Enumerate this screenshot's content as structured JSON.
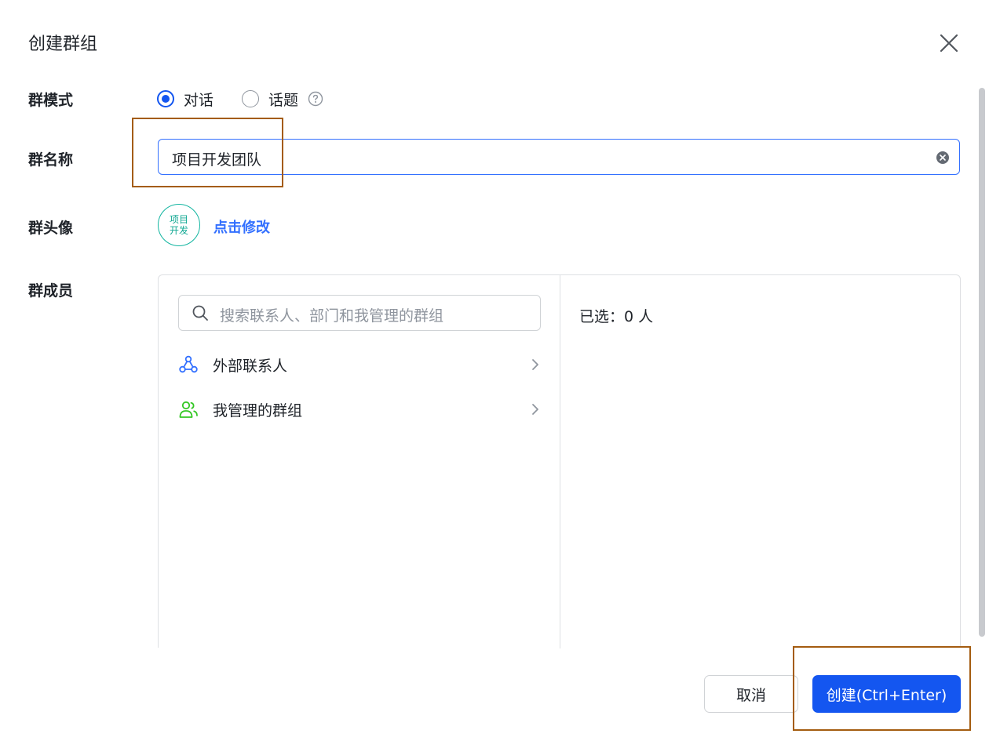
{
  "dialog": {
    "title": "创建群组"
  },
  "form": {
    "mode_label": "群模式",
    "mode_options": [
      "对话",
      "话题"
    ],
    "mode_selected": "对话",
    "name_label": "群名称",
    "name_value": "项目开发团队",
    "avatar_label": "群头像",
    "avatar_text_line1": "项目",
    "avatar_text_line2": "开发",
    "avatar_modify": "点击修改",
    "members_label": "群成员"
  },
  "members": {
    "search_placeholder": "搜索联系人、部门和我管理的群组",
    "rows": [
      "外部联系人",
      "我管理的群组"
    ],
    "selected_text": "已选：0 人"
  },
  "footer": {
    "cancel": "取消",
    "create": "创建(Ctrl+Enter)"
  },
  "colors": {
    "accent": "#1456f0",
    "link": "#3370ff",
    "avatar": "#12b5a0",
    "highlight_box": "#a45c10"
  }
}
